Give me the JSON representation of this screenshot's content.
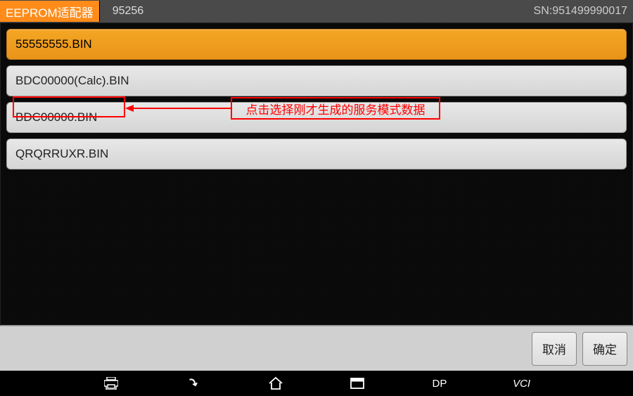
{
  "header": {
    "title": "EEPROM适配器",
    "subtitle": "95256",
    "serial": "SN:951499990017"
  },
  "files": [
    {
      "name": "55555555.BIN",
      "selected": true
    },
    {
      "name": "BDC00000(Calc).BIN",
      "selected": false
    },
    {
      "name": "BDC00000.BIN",
      "selected": false
    },
    {
      "name": "QRQRRUXR.BIN",
      "selected": false
    }
  ],
  "annotation": {
    "text": "点击选择刚才生成的服务模式数据"
  },
  "buttons": {
    "cancel": "取消",
    "confirm": "确定"
  },
  "nav": {
    "dp": "DP",
    "vci": "VCI"
  }
}
